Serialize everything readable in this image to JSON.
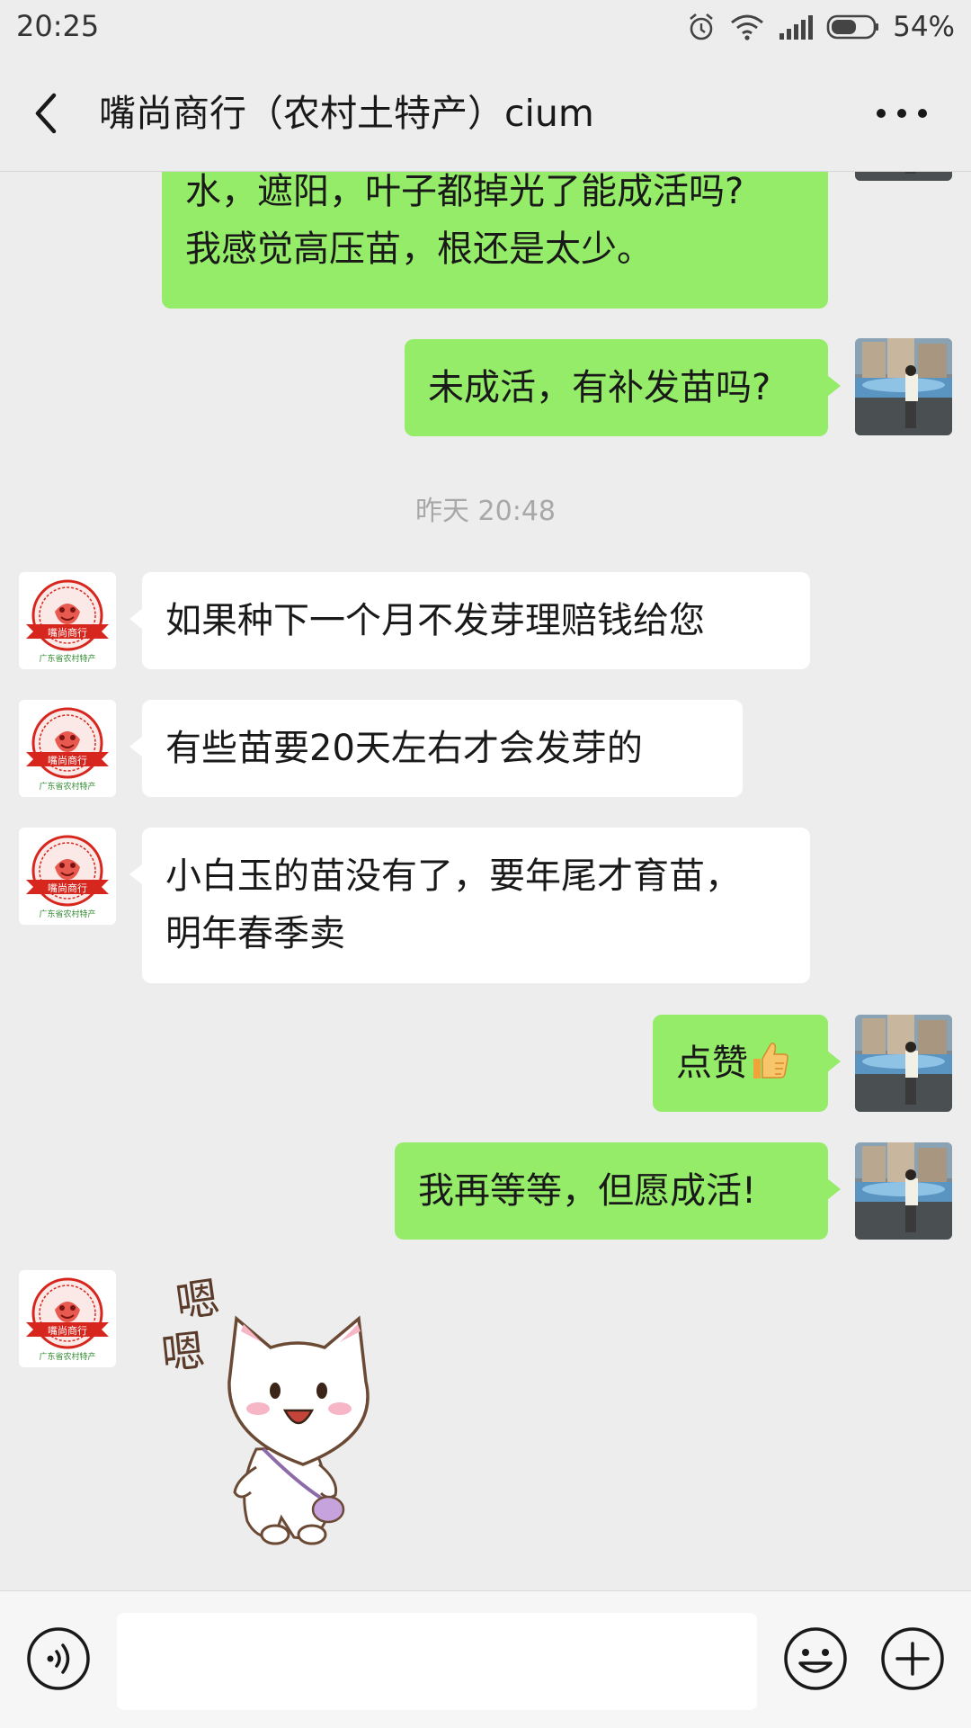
{
  "status_bar": {
    "time": "20:25",
    "battery_percent": "54%",
    "icons": [
      "alarm-icon",
      "wifi-icon",
      "signal-icon",
      "battery-icon"
    ]
  },
  "header": {
    "title": "嘴尚商行（农村土特产）cium",
    "back_icon": "chevron-left-icon",
    "more_icon": "more-dots-icon"
  },
  "messages": [
    {
      "side": "out",
      "lines": [
        "水，遮阳，叶子都掉光了能成活吗?",
        "我感觉高压苗，根还是太少。"
      ]
    },
    {
      "side": "out",
      "text": "未成活，有补发苗吗?"
    },
    {
      "timestamp": "昨天 20:48"
    },
    {
      "side": "in",
      "text": "如果种下一个月不发芽理赔钱给您"
    },
    {
      "side": "in",
      "text": "有些苗要20天左右才会发芽的"
    },
    {
      "side": "in",
      "lines": [
        "小白玉的苗没有了，要年尾才育苗，",
        "明年春季卖"
      ]
    },
    {
      "side": "out",
      "text": "点赞",
      "emoji": "thumbs-up-icon"
    },
    {
      "side": "out",
      "text": "我再等等，但愿成活!"
    },
    {
      "side": "in",
      "sticker": "cat-sticker",
      "sticker_text": [
        "嗯",
        "嗯"
      ]
    }
  ],
  "contact_avatar": {
    "logo_text": "嘴尚商行",
    "caption": "广东省农村特产"
  },
  "input_bar": {
    "voice_icon": "voice-icon",
    "text_value": "",
    "emoji_icon": "smiley-icon",
    "plus_icon": "plus-icon"
  },
  "colors": {
    "background": "#ededed",
    "outgoing_bubble": "#95ec69",
    "incoming_bubble": "#ffffff",
    "logo_red": "#d7261e",
    "logo_green": "#2f8a2f"
  }
}
